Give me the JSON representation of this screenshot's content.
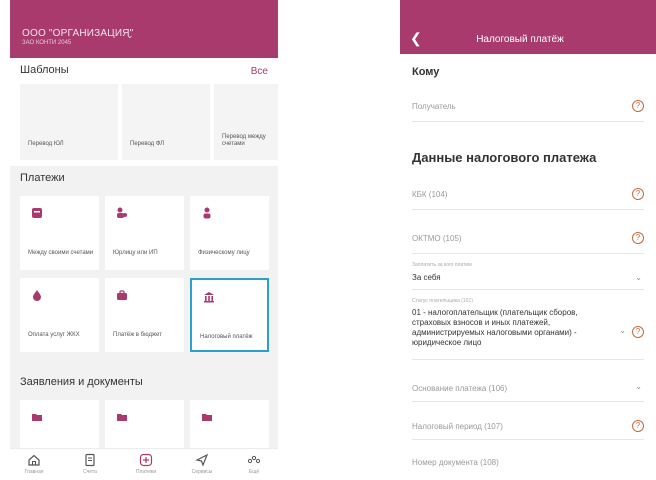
{
  "left": {
    "org_name": "ООО \"ОРГАНИЗАЦИЯ\"",
    "org_sub": "ЗАО КОНТИ 2045",
    "templates": {
      "title": "Шаблоны",
      "all": "Все",
      "items": [
        "Перевод ЮЛ",
        "Перевод ФЛ",
        "Перевод между счетами"
      ]
    },
    "payments": {
      "title": "Платежи",
      "tiles": [
        {
          "label": "Между своими счетами",
          "icon": "card-icon"
        },
        {
          "label": "Юрлицу или ИП",
          "icon": "people-icon"
        },
        {
          "label": "Физическому лицу",
          "icon": "person-icon"
        },
        {
          "label": "Оплата услуг ЖКХ",
          "icon": "drop-icon"
        },
        {
          "label": "Платёж в бюджет",
          "icon": "briefcase-icon"
        },
        {
          "label": "Налоговый платёж",
          "icon": "bank-icon"
        }
      ]
    },
    "documents": {
      "title": "Заявления и документы"
    },
    "nav": [
      "Главная",
      "Счета",
      "Платежи",
      "Сервисы",
      "Ещё"
    ]
  },
  "right": {
    "header_title": "Налоговый платёж",
    "to_heading": "Кому",
    "recipient_ph": "Получатель",
    "tax_heading": "Данные налогового платежа",
    "kbk_ph": "КБК (104)",
    "oktmo_ph": "ОКТМО (105)",
    "pay_for_label": "Заплатить за кого платим",
    "pay_for_value": "За себя",
    "status_label": "Статус плательщика (101)",
    "status_value": "01 - налогоплательщик (плательщик сборов, страховых взносов и иных платежей, администрируемых налоговыми органами) - юридическое лицо",
    "basis_ph": "Основание платежа (106)",
    "period_ph": "Налоговый период (107)",
    "docnum_ph": "Номер документа (108)"
  },
  "colors": {
    "brand": "#a83a6e",
    "highlight": "#2aa0cf",
    "help": "#c66a3e"
  }
}
